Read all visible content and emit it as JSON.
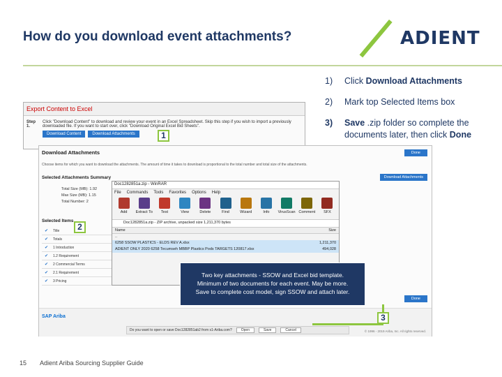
{
  "header": {
    "title": "How do you download event attachments?",
    "logo_text": "ADIENT"
  },
  "steps": [
    {
      "num": "1)",
      "pre": "Click ",
      "bold": "Download Attachments",
      "post": ""
    },
    {
      "num": "2)",
      "pre": "Mark top Selected Items box",
      "bold": "",
      "post": ""
    },
    {
      "num": "3)",
      "pre": "",
      "bold": "Save",
      "post": " .zip folder so complete the documents later, then click ",
      "bold2": "Done"
    }
  ],
  "export_window": {
    "title": "Export Content to Excel",
    "step_label": "Step 1.",
    "step_text": "Click \"Download Content\" to download and review your event in an Excel Spreadsheet. Skip this step if you wish to import a previously downloaded file. If you want to start over, click \"Download Original Excel Bid Sheets\".",
    "btn_content": "Download Content",
    "btn_attachments": "Download Attachments"
  },
  "download_window": {
    "title": "Download Attachments",
    "done": "Done",
    "description": "Choose items for which you want to download the attachments. The amount of time it takes to download is proportional to the total number and total size of the attachments.",
    "download_btn": "Download Attachments",
    "summary_title": "Selected Attachments Summary",
    "summary": [
      {
        "label": "Total Size (MB):",
        "value": "1.92"
      },
      {
        "label": "Max Size (MB):",
        "value": "1.15"
      },
      {
        "label": "Total Number:",
        "value": "2"
      }
    ],
    "items_title": "Selected Items",
    "items_header": "Title",
    "items": [
      "Totals",
      "1  Introduction",
      "1.2 Requirement",
      "2  Commercial Terms",
      "2.1 Requirement",
      "3  Pricing"
    ],
    "ariba_logo": "SAP Ariba",
    "copyright": "© 1996 - 2019 Ariba, Inc. All rights reserved.",
    "dlbar_text": "Do you want to open or save Doc1282851ab2 from s1-Ariba.com?",
    "dlbar_open": "Open",
    "dlbar_save": "Save",
    "dlbar_cancel": "Cancel"
  },
  "winrar": {
    "title": "Doc1282851a.zip - WinRAR",
    "menu": [
      "File",
      "Commands",
      "Tools",
      "Favorites",
      "Options",
      "Help"
    ],
    "tools": [
      {
        "label": "Add",
        "color": "#b03a2e"
      },
      {
        "label": "Extract To",
        "color": "#5a3d8a"
      },
      {
        "label": "Test",
        "color": "#c0392b"
      },
      {
        "label": "View",
        "color": "#2e86c1"
      },
      {
        "label": "Delete",
        "color": "#6c3483"
      },
      {
        "label": "Find",
        "color": "#1f618d"
      },
      {
        "label": "Wizard",
        "color": "#b9770e"
      },
      {
        "label": "Info",
        "color": "#2874a6"
      },
      {
        "label": "VirusScan",
        "color": "#117a65"
      },
      {
        "label": "Comment",
        "color": "#7d6608"
      },
      {
        "label": "SFX",
        "color": "#922b21"
      }
    ],
    "path": "Doc1282851a.zip - ZIP archive, unpacked size 1,211,370 bytes",
    "col_name": "Name",
    "col_size": "Size",
    "rows": [
      {
        "name": "..",
        "size": ""
      },
      {
        "name": "6258 SSOW PLASTICS - ELDS REV A.xlsx",
        "size": "1,211,370"
      },
      {
        "name": "ADIENT ONLY 2020 6258 Tecumseh MBBP Plastics Pods TARGETS 120817.xlsx",
        "size": "494,028"
      }
    ]
  },
  "callout": {
    "line1": "Two key attachments - SSOW and Excel bid template.",
    "line2": "Minimum of two documents for each event. May be more.",
    "line3": "Save to complete cost model, sign SSOW and attach later."
  },
  "badges": [
    "1",
    "2",
    "3"
  ],
  "footer": {
    "page_number": "15",
    "text": "Adient Ariba Sourcing Supplier Guide"
  },
  "colors": {
    "navy": "#1f3864",
    "green": "#8dc63f",
    "ariba_blue": "#2a75c9"
  }
}
